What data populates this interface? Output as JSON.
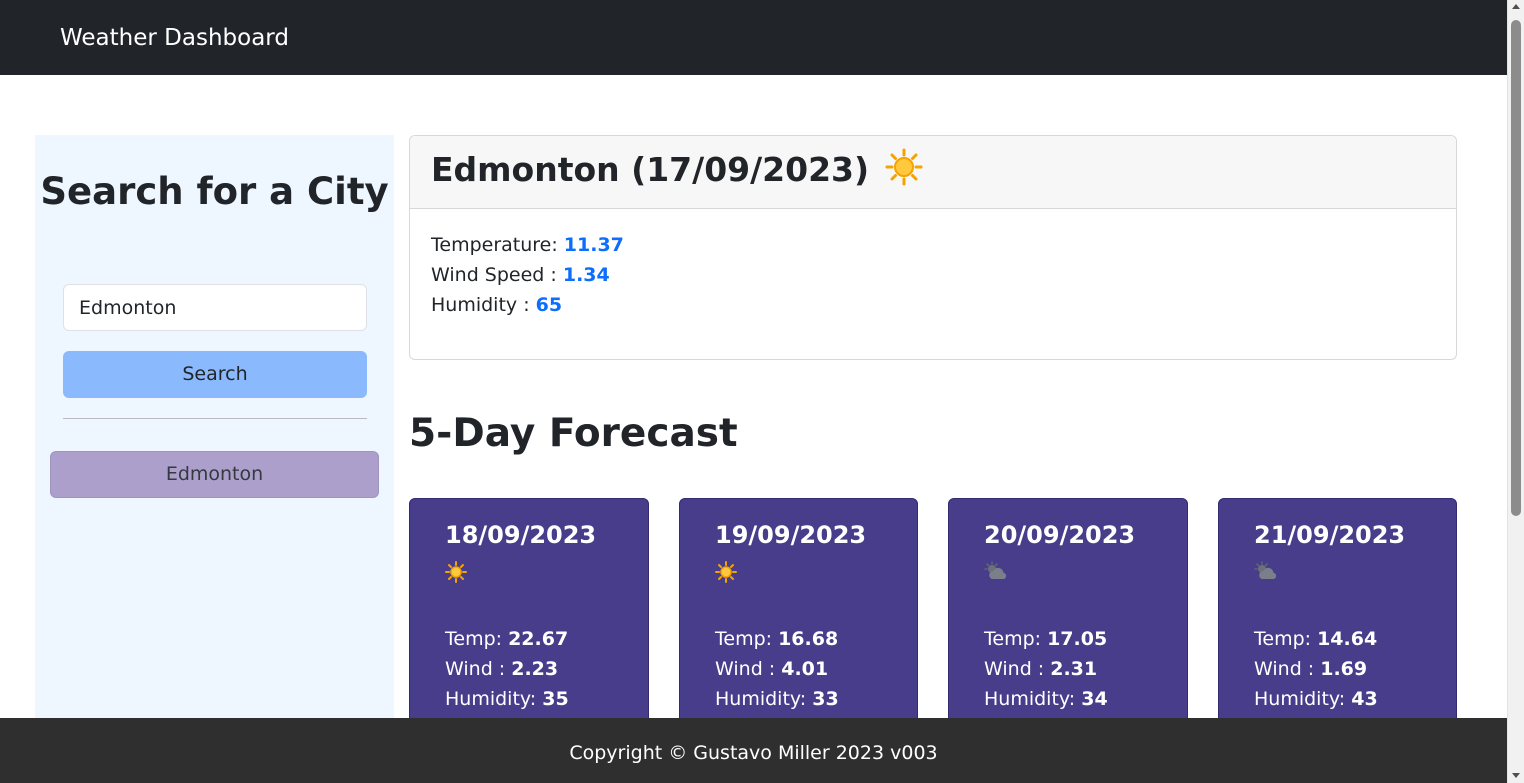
{
  "header": {
    "title": "Weather Dashboard"
  },
  "sidebar": {
    "title": "Search for a City",
    "search_input_value": "Edmonton",
    "search_button_label": "Search",
    "history": [
      "Edmonton"
    ]
  },
  "current": {
    "title": "Edmonton (17/09/2023)",
    "icon": "sun-icon",
    "temperature_label": "Temperature: ",
    "temperature": "11.37",
    "wind_label": "Wind Speed : ",
    "wind": "1.34",
    "humidity_label": "Humidity : ",
    "humidity": "65"
  },
  "forecast": {
    "title": "5-Day Forecast",
    "temp_label": "Temp: ",
    "wind_label": "Wind : ",
    "humidity_label": "Humidity: ",
    "days": [
      {
        "date": "18/09/2023",
        "icon": "sun-icon",
        "temp": "22.67",
        "wind": "2.23",
        "humidity": "35"
      },
      {
        "date": "19/09/2023",
        "icon": "sun-icon",
        "temp": "16.68",
        "wind": "4.01",
        "humidity": "33"
      },
      {
        "date": "20/09/2023",
        "icon": "cloud-sun-icon",
        "temp": "17.05",
        "wind": "2.31",
        "humidity": "34"
      },
      {
        "date": "21/09/2023",
        "icon": "cloud-sun-icon",
        "temp": "14.64",
        "wind": "1.69",
        "humidity": "43"
      }
    ]
  },
  "footer": {
    "text": "Copyright © Gustavo Miller 2023 v003"
  },
  "colors": {
    "navbar": "#212529",
    "sidebar_bg": "#eef6ff",
    "search_button": "#8bb9fe",
    "history_button": "#ad9fcc",
    "value_blue": "#0d6efd",
    "forecast_card": "#483d8b",
    "footer": "#2f2f2f"
  }
}
